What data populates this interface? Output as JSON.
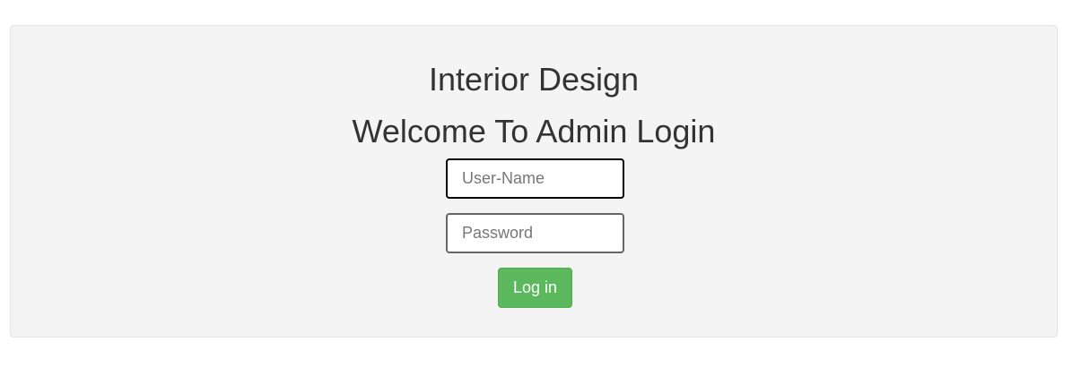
{
  "login": {
    "app_title": "Interior Design",
    "heading": "Welcome To Admin Login",
    "username_placeholder": "User-Name",
    "password_placeholder": "Password",
    "submit_label": "Log in"
  },
  "colors": {
    "panel_background": "#f4f4f4",
    "button_background": "#5cb85c",
    "text": "#333333"
  }
}
